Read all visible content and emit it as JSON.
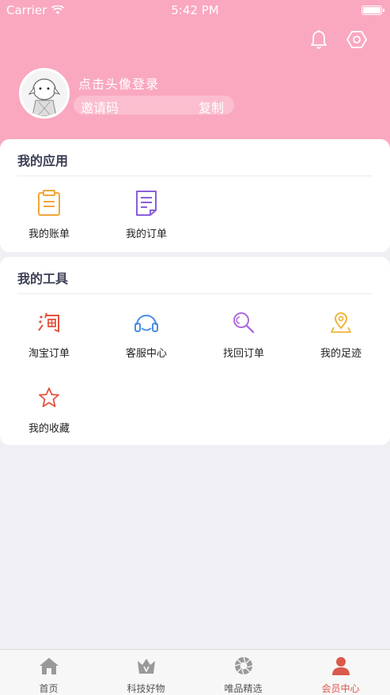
{
  "status_bar": {
    "carrier": "Carrier",
    "time": "5:42 PM"
  },
  "profile": {
    "login_prompt": "点击头像登录",
    "invite_label": "邀请码",
    "copy_label": "复制"
  },
  "my_apps": {
    "title": "我的应用",
    "items": [
      {
        "label": "我的账单",
        "icon": "bill-icon"
      },
      {
        "label": "我的订单",
        "icon": "order-icon"
      }
    ]
  },
  "my_tools": {
    "title": "我的工具",
    "items": [
      {
        "label": "淘宝订单",
        "icon": "taobao-icon"
      },
      {
        "label": "客服中心",
        "icon": "headset-icon"
      },
      {
        "label": "找回订单",
        "icon": "search-icon"
      },
      {
        "label": "我的足迹",
        "icon": "location-icon"
      },
      {
        "label": "我的收藏",
        "icon": "star-icon"
      }
    ]
  },
  "tabbar": {
    "tabs": [
      {
        "label": "首页",
        "icon": "home-icon"
      },
      {
        "label": "科技好物",
        "icon": "crown-icon"
      },
      {
        "label": "唯品精选",
        "icon": "aperture-icon"
      },
      {
        "label": "会员中心",
        "icon": "user-icon"
      }
    ],
    "active_index": 3
  },
  "colors": {
    "header": "#f9a8bf",
    "bill": "#f2a63a",
    "order": "#8a5ed8",
    "taobao": "#e5533d",
    "headset": "#4a8ee6",
    "search": "#b06be0",
    "location": "#f0b43a",
    "star": "#e5533d",
    "tab_active": "#d95a4c"
  }
}
